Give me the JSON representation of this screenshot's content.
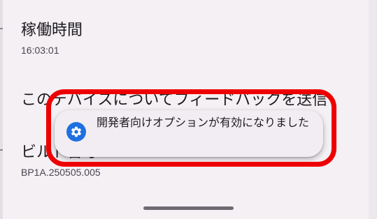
{
  "settings": {
    "uptime": {
      "title": "稼働時間",
      "value": "16:03:01"
    },
    "feedback": {
      "title": "このデバイスについてフィードバックを送信"
    },
    "build": {
      "title": "ビルド番号",
      "value": "BP1A.250505.005"
    }
  },
  "toast": {
    "icon": "settings-gear-icon",
    "message": "開発者向けオプションが有効になりました"
  },
  "colors": {
    "highlight": "#ee0000",
    "toast_icon": "#1f6fe0",
    "background": "#f4f0f4"
  }
}
